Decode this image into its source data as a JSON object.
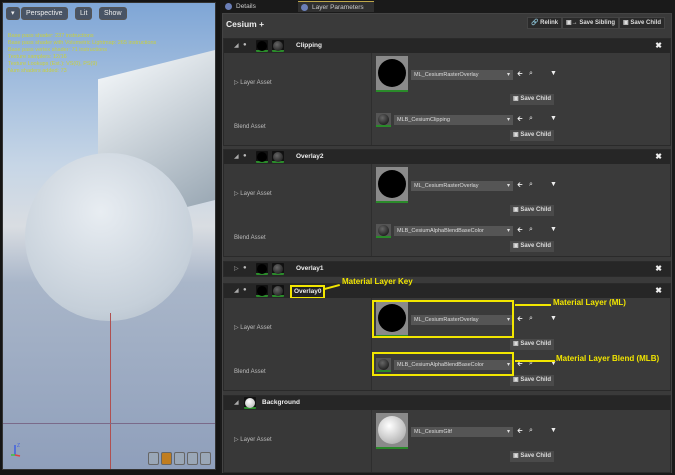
{
  "viewport": {
    "buttons": {
      "menu": "▾",
      "perspective": "Perspective",
      "lit": "Lit",
      "show": "Show"
    },
    "stats": [
      "Base pass shader: 237 instructions",
      "Base pass shader with Volumetric Lightmap: 265 instructions",
      "Base pass vertex shader: 71 instructions",
      "Texture samplers: 12/16",
      "Texture Lookups (Est.): VS(0), PS(9)",
      "Num shaders added: 73"
    ],
    "axis_label": "Z"
  },
  "tabs": [
    {
      "label": "Details"
    },
    {
      "label": "Layer Parameters"
    }
  ],
  "header": {
    "title": "Cesium",
    "add": "+",
    "relink": "Relink",
    "save_sibling": "Save Sibling",
    "save_child": "Save Child"
  },
  "labels": {
    "layer_asset": "Layer Asset",
    "blend_asset": "Blend Asset",
    "save_child": "Save Child",
    "close": "✖"
  },
  "layers": [
    {
      "name": "Clipping",
      "layer_asset": "ML_CesiumRasterOverlay",
      "blend_asset": "MLB_CesiumClipping"
    },
    {
      "name": "Overlay2",
      "layer_asset": "ML_CesiumRasterOverlay",
      "blend_asset": "MLB_CesiumAlphaBlendBaseColor"
    },
    {
      "name": "Overlay1"
    },
    {
      "name": "Overlay0",
      "layer_asset": "ML_CesiumRasterOverlay",
      "blend_asset": "MLB_CesiumAlphaBlendBaseColor"
    },
    {
      "name": "Background",
      "layer_asset": "ML_CesiumGltf"
    }
  ],
  "annotations": {
    "key": "Material Layer Key",
    "ml": "Material Layer (ML)",
    "mlb": "Material Layer Blend (MLB)",
    "color": "#f2e600"
  }
}
